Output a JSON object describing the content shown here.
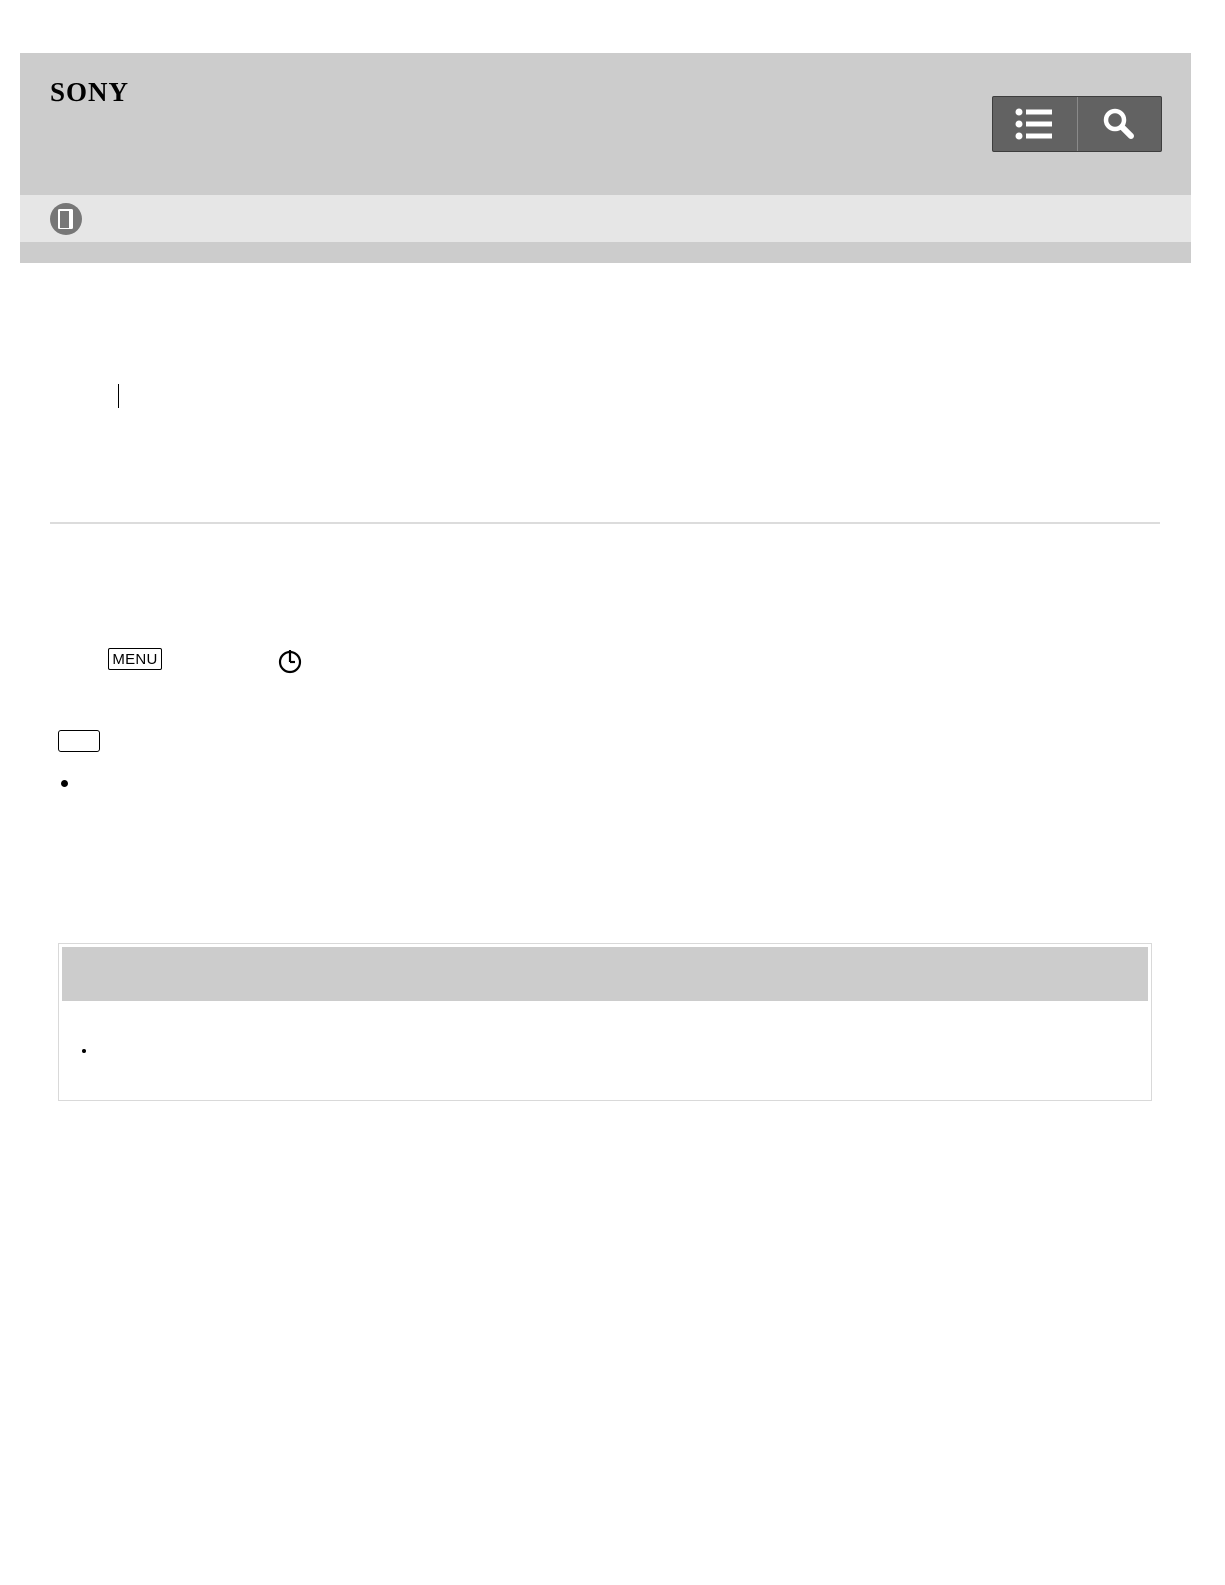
{
  "header": {
    "brand": "SONY",
    "toc_icon": "list-icon",
    "search_icon": "search-icon"
  },
  "subbar": {
    "icon": "manual-book-icon"
  },
  "instructions": {
    "menu_key_label": "MENU",
    "timer_icon": "self-timer-icon"
  },
  "colors": {
    "header_bg": "#cccccc",
    "subbar_bg": "#e6e6e6",
    "button_bg": "#626262"
  }
}
